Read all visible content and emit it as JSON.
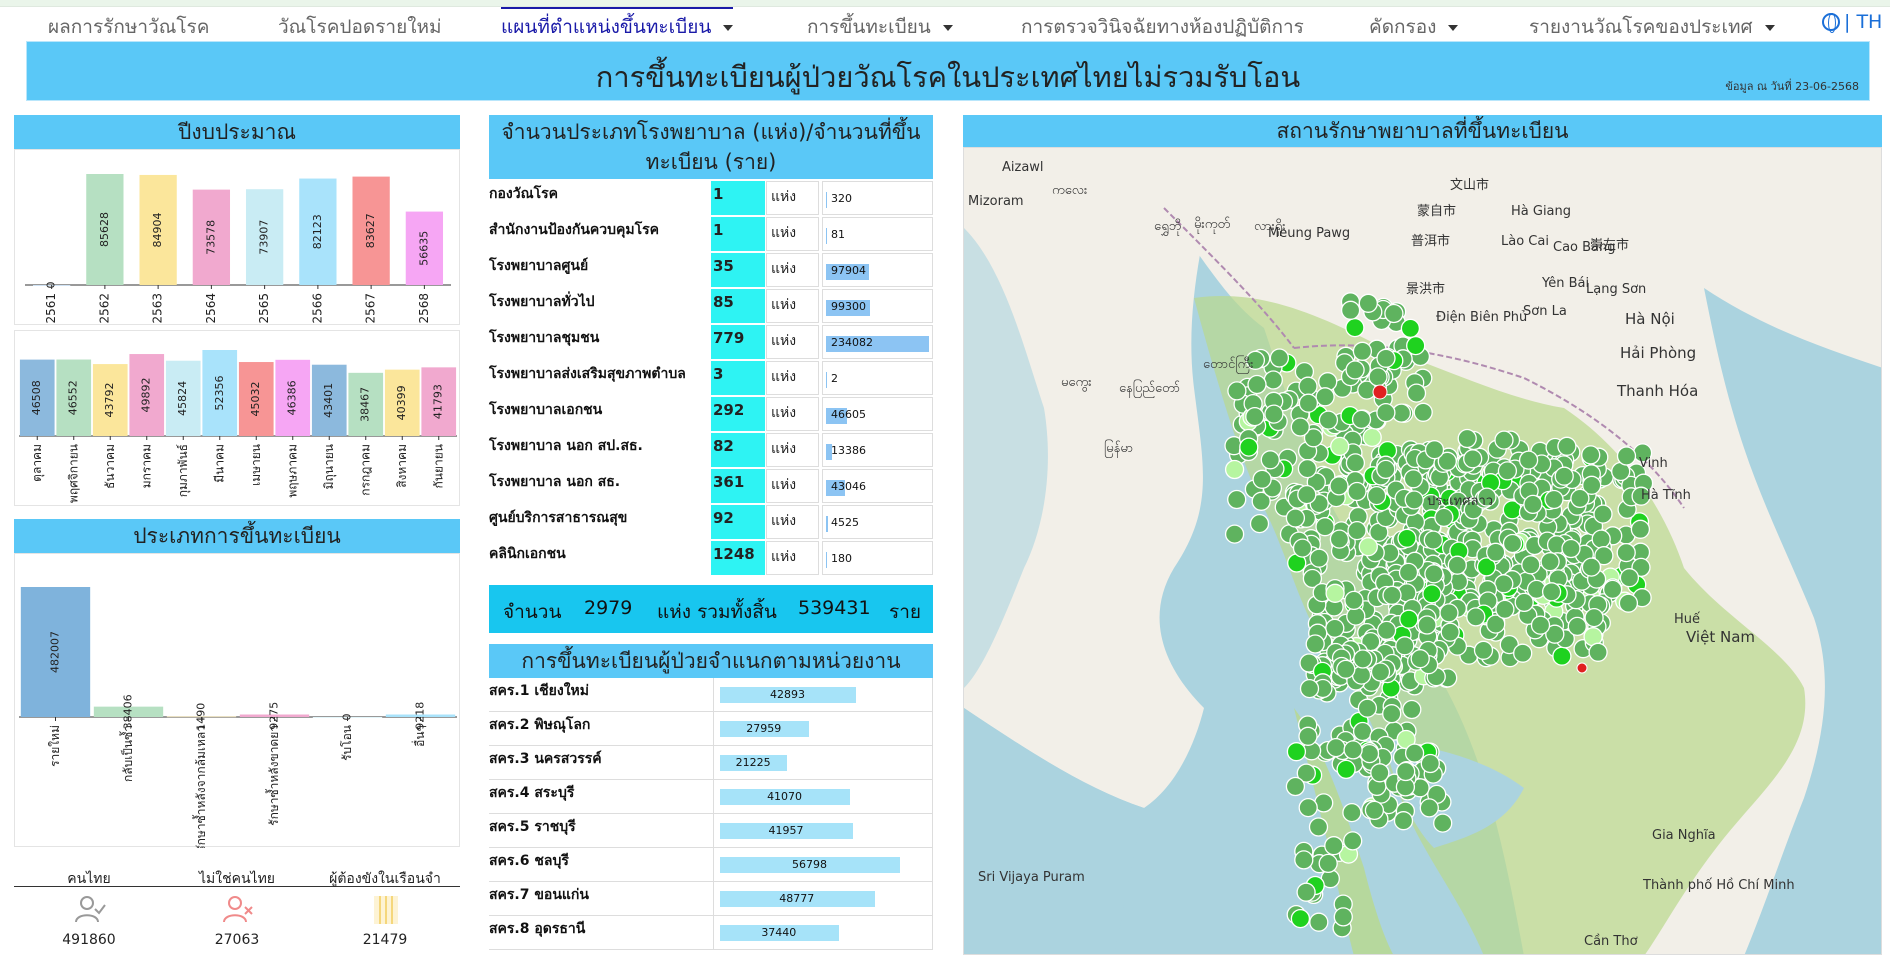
{
  "nav": {
    "items": [
      {
        "label": "ผลการรักษาวัณโรค"
      },
      {
        "label": "วัณโรคปอดรายใหม่"
      },
      {
        "label": "แผนที่ตำแหน่งขึ้นทะเบียน"
      },
      {
        "label": "การขึ้นทะเบียน"
      },
      {
        "label": "การตรวจวินิจฉัยทางห้องปฏิบัติการ"
      },
      {
        "label": "คัดกรอง"
      },
      {
        "label": "รายงานวัณโรคของประเทศ"
      }
    ],
    "lang": "| TH"
  },
  "header": {
    "title": "การขึ้นทะเบียนผู้ป่วยวัณโรคในประเทศไทยไม่รวมรับโอน",
    "date_note": "ข้อมูล ณ วันที่ 23-06-2568"
  },
  "panels": {
    "budget_title": "ปีงบประมาณ",
    "reg_type_title": "ประเภทการขึ้นทะเบียน",
    "hospital_title": "จำนวนประเภทโรงพยาบาล (แห่ง)/จำนวนที่ขึ้นทะเบียน (ราย)",
    "region_title": "การขึ้นทะเบียนผู้ป่วยจำแนกตามหน่วยงาน",
    "map_title": "สถานรักษาพยาบาลที่ขึ้นทะเบียน"
  },
  "colors": {
    "accent": "#5ac8f7",
    "summary_bg": "#18c6ef",
    "count_cell": "#2ef3f3",
    "marker_green": "#5fb35f",
    "marker_bright": "#1fd21f",
    "marker_red": "#e02020"
  },
  "chart_data": [
    {
      "type": "bar",
      "categories": [
        "2561",
        "2562",
        "2563",
        "2564",
        "2565",
        "2566",
        "2567",
        "2568"
      ],
      "values": [
        0,
        85628,
        84904,
        73578,
        73907,
        82123,
        83627,
        56635
      ],
      "colors": [
        "#9fc5e8",
        "#b6e0c2",
        "#fbe69b",
        "#f1a9cf",
        "#c9ecf4",
        "#a9e3fb",
        "#f79595",
        "#f6a6f4"
      ],
      "title": "ปีงบประมาณ"
    },
    {
      "type": "bar",
      "categories": [
        "ตุลาคม",
        "พฤศจิกายน",
        "ธันวาคม",
        "มกราคม",
        "กุมภาพันธ์",
        "มีนาคม",
        "เมษายน",
        "พฤษภาคม",
        "มิถุนายน",
        "กรกฎาคม",
        "สิงหาคม",
        "กันยายน"
      ],
      "values": [
        46508,
        46552,
        43792,
        49892,
        45824,
        52356,
        45032,
        46386,
        43401,
        38467,
        40399,
        41793
      ],
      "colors": [
        "#8cb9dd",
        "#b6e0c2",
        "#fbe69b",
        "#f1a9cf",
        "#c9ecf4",
        "#a9e3fb",
        "#f79595",
        "#f6a6f4",
        "#8cb9dd",
        "#b6e0c2",
        "#fbe69b",
        "#f1a9cf"
      ],
      "ylim": [
        0,
        52356
      ]
    },
    {
      "type": "bar",
      "categories": [
        "รายใหม่",
        "กลับเป็นซ้ำ",
        "รักษาซ้ำหลังจากล้มเหลว",
        "รักษาซ้ำหลังขาดยา",
        "รับโอน",
        "อื่นๆ"
      ],
      "values": [
        482007,
        38406,
        1490,
        9275,
        0,
        9218
      ],
      "colors": [
        "#7fb3dc",
        "#b6e0c2",
        "#fbe69b",
        "#f1a9cf",
        "#c9ecf4",
        "#a9e3fb"
      ],
      "title": "ประเภทการขึ้นทะเบียน"
    },
    {
      "type": "table",
      "title": "จำนวนประเภทโรงพยาบาล (แห่ง)/จำนวนที่ขึ้นทะเบียน (ราย)",
      "unit": "แห่ง",
      "rows": [
        {
          "name": "กองวัณโรค",
          "count": "1",
          "registered": 320
        },
        {
          "name": "สำนักงานป้องกันควบคุมโรค",
          "count": "1",
          "registered": 81
        },
        {
          "name": "โรงพยาบาลศูนย์",
          "count": "35",
          "registered": 97904
        },
        {
          "name": "โรงพยาบาลทั่วไป",
          "count": "85",
          "registered": 99300
        },
        {
          "name": "โรงพยาบาลชุมชน",
          "count": "779",
          "registered": 234082
        },
        {
          "name": "โรงพยาบาลส่งเสริมสุขภาพตำบล",
          "count": "3",
          "registered": 2
        },
        {
          "name": "โรงพยาบาลเอกชน",
          "count": "292",
          "registered": 46605
        },
        {
          "name": "โรงพยาบาล นอก สป.สธ.",
          "count": "82",
          "registered": 13386
        },
        {
          "name": "โรงพยาบาล นอก สธ.",
          "count": "361",
          "registered": 43046
        },
        {
          "name": "ศูนย์บริการสาธารณสุข",
          "count": "92",
          "registered": 4525
        },
        {
          "name": "คลินิกเอกชน",
          "count": "1248",
          "registered": 180
        }
      ]
    },
    {
      "type": "bar",
      "title": "การขึ้นทะเบียนผู้ป่วยจำแนกตามหน่วยงาน",
      "categories": [
        "สคร.1 เชียงใหม่",
        "สคร.2 พิษณุโลก",
        "สคร.3 นครสวรรค์",
        "สคร.4 สระบุรี",
        "สคร.5 ราชบุรี",
        "สคร.6 ชลบุรี",
        "สคร.7 ขอนแก่น",
        "สคร.8 อุดรธานี"
      ],
      "values": [
        42893,
        27959,
        21225,
        41070,
        41957,
        56798,
        48777,
        37440
      ]
    }
  ],
  "summary": {
    "label": "จำนวน",
    "facilities": "2979",
    "facilities_unit": "แห่ง รวมทั้งสิ้น",
    "patients": "539431",
    "patients_unit": "ราย"
  },
  "patient_stats": [
    {
      "label": "คนไทย",
      "value": "491860",
      "icon": "user-check-icon"
    },
    {
      "label": "ไม่ใช่คนไทย",
      "value": "27063",
      "icon": "user-x-icon"
    },
    {
      "label": "ผู้ต้องขังในเรือนจำ",
      "value": "21479",
      "icon": "prison-bars-icon"
    }
  ],
  "map": {
    "labels": [
      {
        "text": "Aizawl"
      },
      {
        "text": "Mizoram"
      },
      {
        "text": "ကလေး"
      },
      {
        "text": "ရွှေဘို"
      },
      {
        "text": "မိုးကုတ်"
      },
      {
        "text": "လားရှိုး"
      },
      {
        "text": "Meung Pawg"
      },
      {
        "text": "普洱市"
      },
      {
        "text": "文山市"
      },
      {
        "text": "蒙自市"
      },
      {
        "text": "Hà Giang"
      },
      {
        "text": "Cao Bằng"
      },
      {
        "text": "崇左市"
      },
      {
        "text": "Lào Cai"
      },
      {
        "text": "景洪市"
      },
      {
        "text": "Yên Bái"
      },
      {
        "text": "Lạng Sơn"
      },
      {
        "text": "Điện Biên Phủ"
      },
      {
        "text": "Sơn La"
      },
      {
        "text": "Hà Nội"
      },
      {
        "text": "Hải Phòng"
      },
      {
        "text": "Thanh Hóa"
      },
      {
        "text": "မကွေး"
      },
      {
        "text": "နေပြည်တော်"
      },
      {
        "text": "တောင်ကြီး"
      },
      {
        "text": "Vinh"
      },
      {
        "text": "Hà Tĩnh"
      },
      {
        "text": "Huế"
      },
      {
        "text": "Việt Nam"
      },
      {
        "text": "Sri Vijaya Puram"
      },
      {
        "text": "Thành phố Hồ Chí Minh"
      },
      {
        "text": "Cần Thơ"
      },
      {
        "text": "Gia Nghĩa"
      },
      {
        "text": "ประเทศลาว"
      },
      {
        "text": "မြန်မာ"
      }
    ]
  }
}
